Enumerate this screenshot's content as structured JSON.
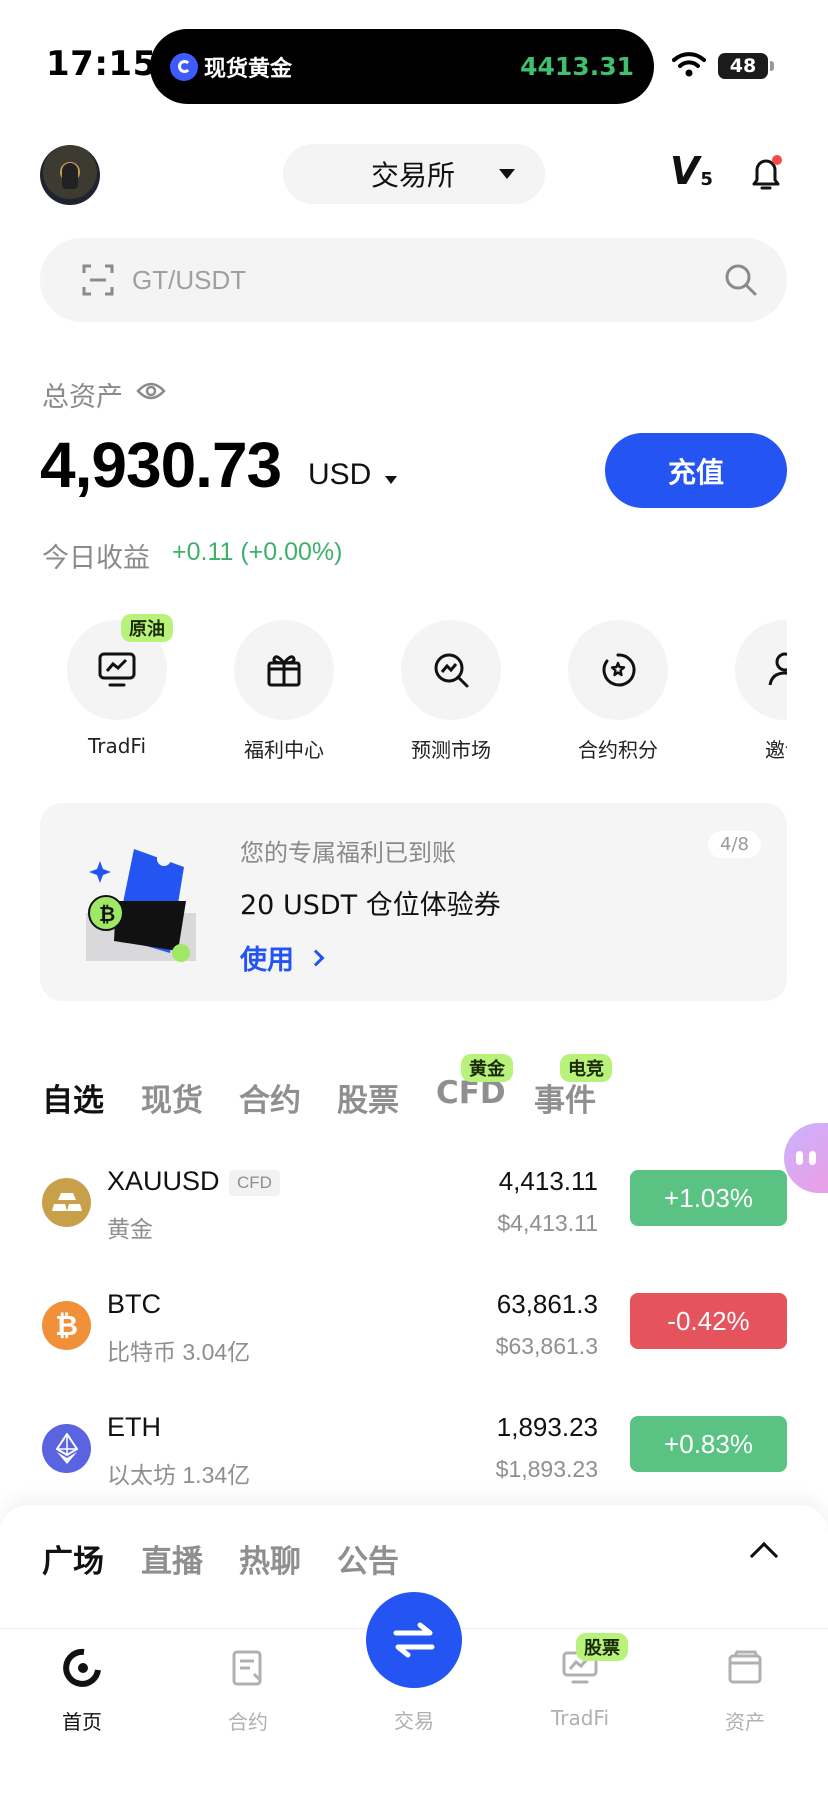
{
  "status_bar": {
    "time": "17:15",
    "island_title": "现货黄金",
    "island_price": "4413.31",
    "battery": "48"
  },
  "header": {
    "exchange_label": "交易所",
    "vip_letter": "V",
    "vip_level": "5"
  },
  "search": {
    "placeholder": "GT/USDT"
  },
  "assets": {
    "label": "总资产",
    "value": "4,930.73",
    "unit": "USD",
    "deposit_label": "充值",
    "today_label": "今日收益",
    "today_value": "+0.11 (+0.00%)"
  },
  "quick_actions": [
    {
      "label": "TradFi",
      "tag": "原油",
      "icon": "chart-board-icon"
    },
    {
      "label": "福利中心",
      "icon": "gift-icon"
    },
    {
      "label": "预测市场",
      "icon": "search-chart-icon"
    },
    {
      "label": "合约积分",
      "icon": "points-icon"
    },
    {
      "label": "邀请",
      "icon": "user-add-icon"
    }
  ],
  "promo": {
    "subtitle": "您的专属福利已到账",
    "title": "20 USDT 仓位体验券",
    "action": "使用",
    "page": "4/8"
  },
  "market_tabs": [
    {
      "label": "自选",
      "active": true
    },
    {
      "label": "现货"
    },
    {
      "label": "合约"
    },
    {
      "label": "股票"
    },
    {
      "label": "CFD",
      "tag": "黄金"
    },
    {
      "label": "事件",
      "tag": "电竞"
    }
  ],
  "market_rows": [
    {
      "symbol": "XAUUSD",
      "tag": "CFD",
      "name": "黄金",
      "price": "4,413.11",
      "price_usd": "$4,413.11",
      "change": "+1.03%",
      "direction": "up",
      "icon": "gold-icon"
    },
    {
      "symbol": "BTC",
      "name": "比特币 3.04亿",
      "price": "63,861.3",
      "price_usd": "$63,861.3",
      "change": "-0.42%",
      "direction": "down",
      "icon": "bitcoin-icon"
    },
    {
      "symbol": "ETH",
      "name": "以太坊 1.34亿",
      "price": "1,893.23",
      "price_usd": "$1,893.23",
      "change": "+0.83%",
      "direction": "up",
      "icon": "ethereum-icon"
    }
  ],
  "sheet_tabs": [
    {
      "label": "广场",
      "active": true
    },
    {
      "label": "直播"
    },
    {
      "label": "热聊"
    },
    {
      "label": "公告"
    }
  ],
  "bottom_nav": {
    "home": "首页",
    "contracts": "合约",
    "trade": "交易",
    "tradfi": "TradFi",
    "tradfi_tag": "股票",
    "assets": "资产"
  },
  "colors": {
    "accent": "#2455f2",
    "up": "#5ac282",
    "down": "#e5545d",
    "tag_green": "#b8f27a"
  }
}
